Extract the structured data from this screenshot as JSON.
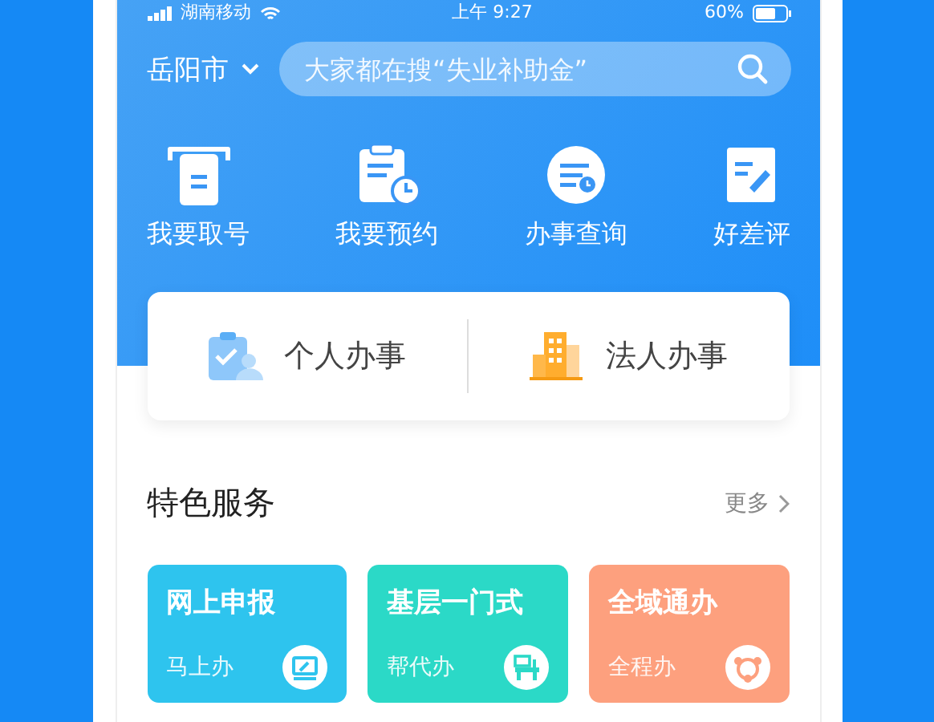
{
  "status_bar": {
    "carrier": "湖南移动",
    "time": "上午 9:27",
    "battery": "60%"
  },
  "location": {
    "city": "岳阳市"
  },
  "search": {
    "placeholder": "大家都在搜“失业补助金”"
  },
  "quick_actions": [
    {
      "label": "我要取号",
      "kind": "ticket"
    },
    {
      "label": "我要预约",
      "kind": "appointment"
    },
    {
      "label": "办事查询",
      "kind": "query"
    },
    {
      "label": "好差评",
      "kind": "review"
    }
  ],
  "service_tabs": [
    {
      "label": "个人办事",
      "kind": "person"
    },
    {
      "label": "法人办事",
      "kind": "company"
    }
  ],
  "section": {
    "title": "特色服务",
    "more": "更多"
  },
  "feature_cards": [
    {
      "title": "网上申报",
      "subtitle": "马上办",
      "color": "#2ec4ee",
      "kind": "monitor"
    },
    {
      "title": "基层一门式",
      "subtitle": "帮代办",
      "color": "#2bd9c7",
      "kind": "desk"
    },
    {
      "title": "全域通办",
      "subtitle": "全程办",
      "color": "#fda07e",
      "kind": "network"
    }
  ]
}
